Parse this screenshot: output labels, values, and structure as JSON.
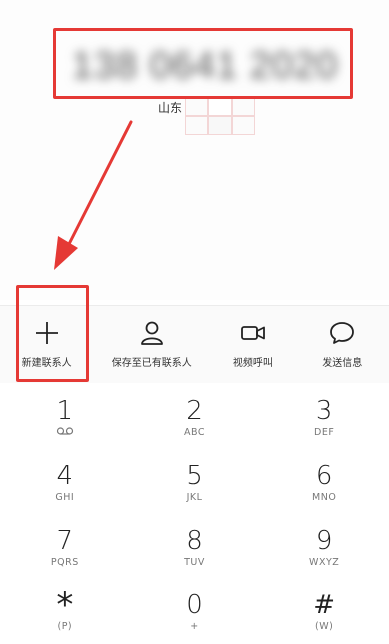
{
  "display": {
    "phone_number": "138 0641 2020",
    "location": "山东"
  },
  "actions": [
    {
      "label": "新建联系人",
      "icon": "plus-icon"
    },
    {
      "label": "保存至已有联系人",
      "icon": "person-icon"
    },
    {
      "label": "视频呼叫",
      "icon": "video-camera-icon"
    },
    {
      "label": "发送信息",
      "icon": "message-bubble-icon"
    }
  ],
  "keypad": [
    {
      "digit": "1",
      "letters": "",
      "icon": "voicemail-icon"
    },
    {
      "digit": "2",
      "letters": "ABC"
    },
    {
      "digit": "3",
      "letters": "DEF"
    },
    {
      "digit": "4",
      "letters": "GHI"
    },
    {
      "digit": "5",
      "letters": "JKL"
    },
    {
      "digit": "6",
      "letters": "MNO"
    },
    {
      "digit": "7",
      "letters": "PQRS"
    },
    {
      "digit": "8",
      "letters": "TUV"
    },
    {
      "digit": "9",
      "letters": "WXYZ"
    },
    {
      "digit": "*",
      "letters": "(P)"
    },
    {
      "digit": "0",
      "letters": "+"
    },
    {
      "digit": "#",
      "letters": "(W)"
    }
  ],
  "colors": {
    "annotation": "#e53935",
    "background": "#ffffff"
  }
}
